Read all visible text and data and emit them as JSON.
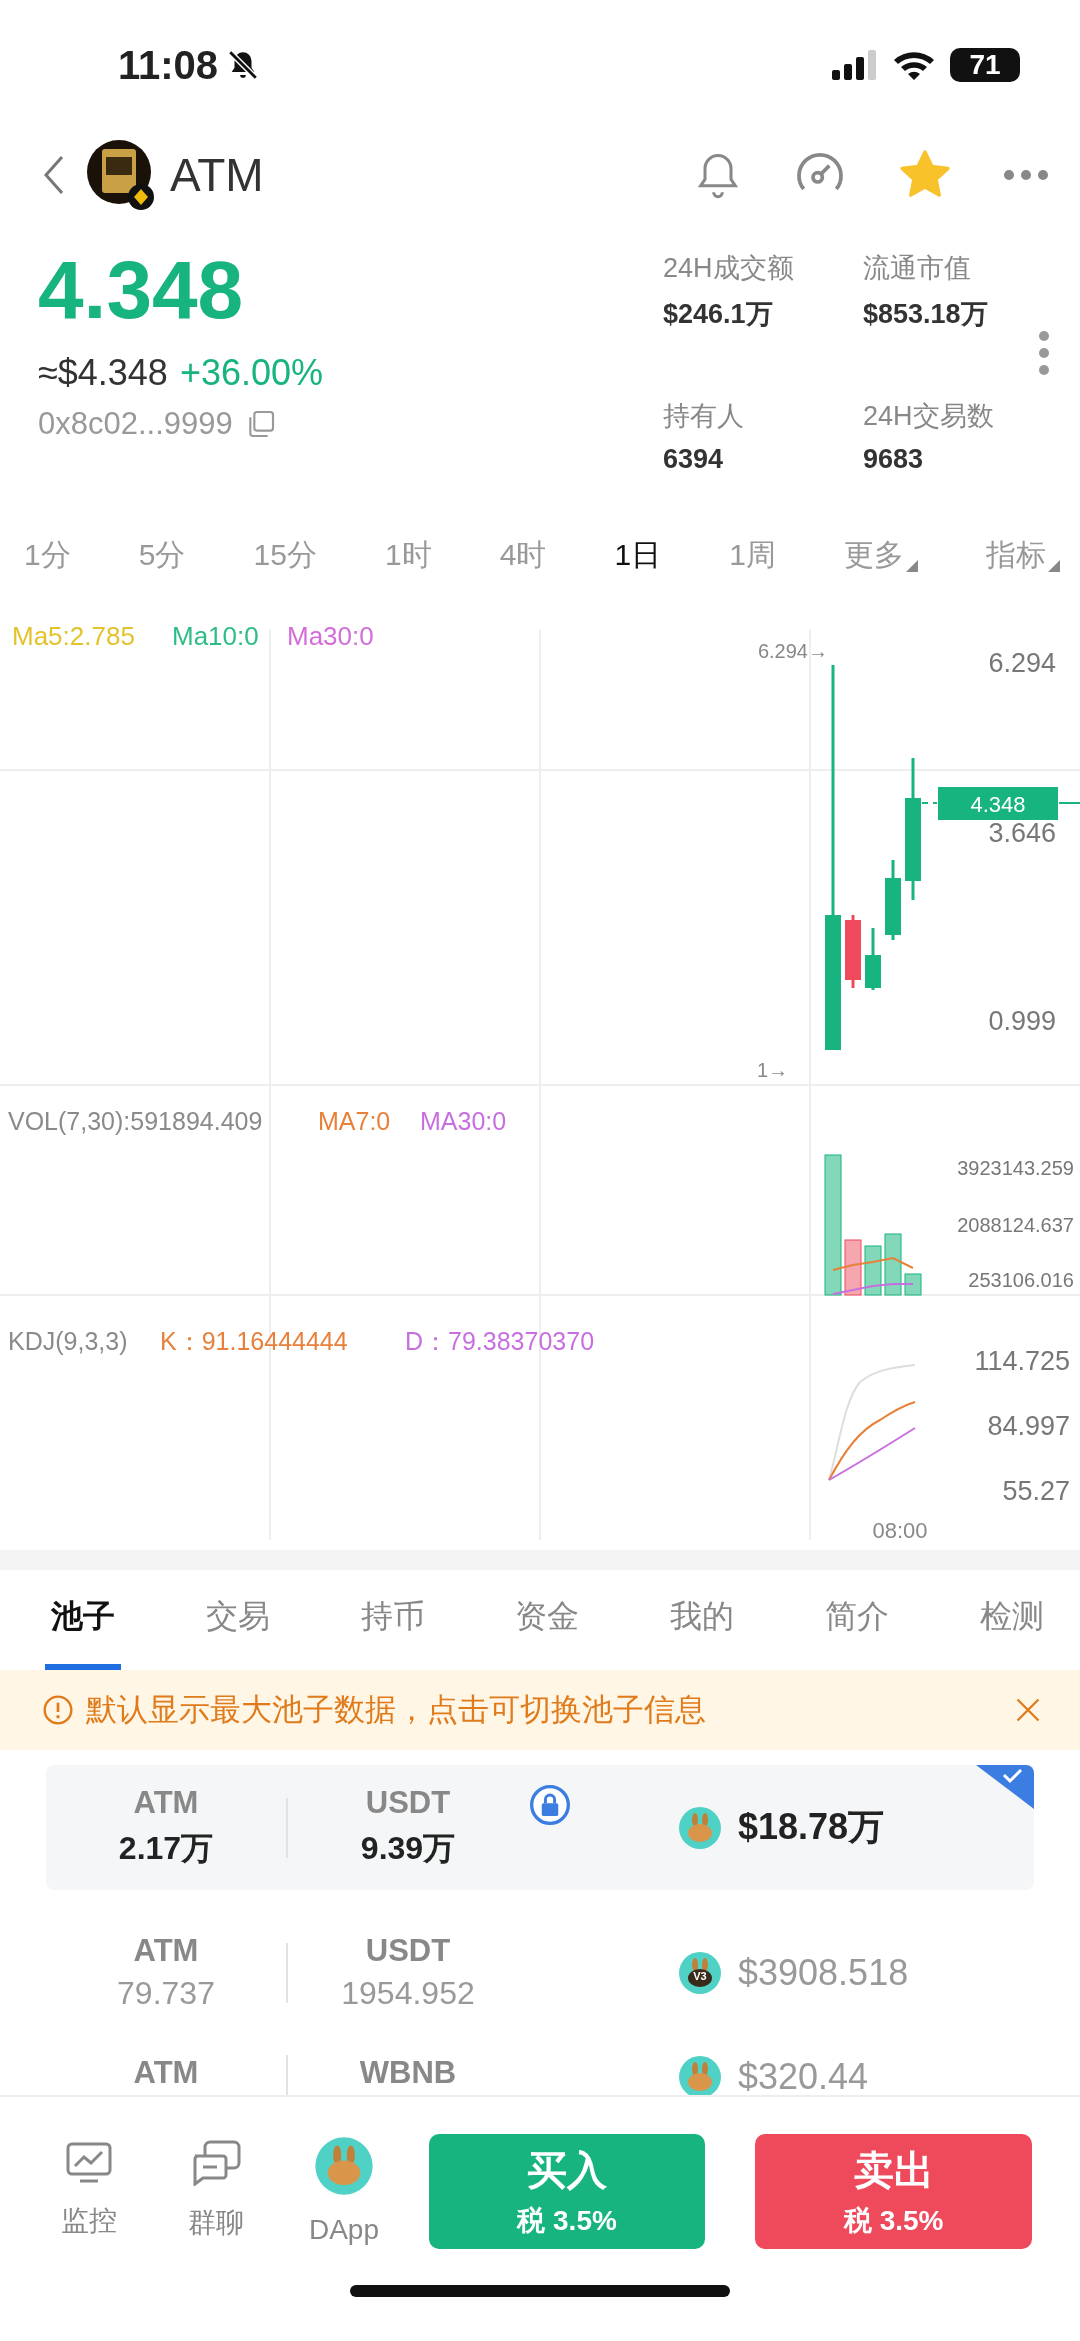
{
  "status_bar": {
    "time": "11:08",
    "battery": "71"
  },
  "header": {
    "title": "ATM",
    "favorite": true
  },
  "price": {
    "value": "4.348",
    "usd": "≈$4.348",
    "change": "+36.00%",
    "address": "0x8c02...9999"
  },
  "stats": [
    {
      "label": "24H成交额",
      "value": "$246.1万"
    },
    {
      "label": "流通市值",
      "value": "$853.18万"
    },
    {
      "label": "持有人",
      "value": "6394"
    },
    {
      "label": "24H交易数",
      "value": "9683"
    }
  ],
  "timeframes": [
    {
      "label": "1分",
      "selected": false,
      "dropdown": false
    },
    {
      "label": "5分",
      "selected": false,
      "dropdown": false
    },
    {
      "label": "15分",
      "selected": false,
      "dropdown": false
    },
    {
      "label": "1时",
      "selected": false,
      "dropdown": false
    },
    {
      "label": "4时",
      "selected": false,
      "dropdown": false
    },
    {
      "label": "1日",
      "selected": true,
      "dropdown": false
    },
    {
      "label": "1周",
      "selected": false,
      "dropdown": false
    },
    {
      "label": "更多",
      "selected": false,
      "dropdown": true
    },
    {
      "label": "指标",
      "selected": false,
      "dropdown": true
    }
  ],
  "chart": {
    "ma_legend": [
      {
        "text": "Ma5:2.785",
        "color": "#e3c22a"
      },
      {
        "text": "Ma10:0",
        "color": "#2ebd85"
      },
      {
        "text": "Ma30:0",
        "color": "#d36ed8"
      }
    ],
    "high_marker": "6.294→",
    "low_marker": "1→",
    "price_axis": [
      "6.294",
      "3.646",
      "0.999"
    ],
    "last_price": "4.348",
    "vol_legend": [
      {
        "text": "VOL(7,30):591894.409",
        "color": "#8a8a8a"
      },
      {
        "text": "MA7:0",
        "color": "#e8803a"
      },
      {
        "text": "MA30:0",
        "color": "#c86fe0"
      }
    ],
    "vol_axis": [
      "3923143.259",
      "2088124.637",
      "253106.016"
    ],
    "kdj_legend": [
      {
        "text": "KDJ(9,3,3)",
        "color": "#8a8a8a"
      },
      {
        "text": "K：91.16444444",
        "color": "#e8803a"
      },
      {
        "text": "D：79.38370370",
        "color": "#c86fe0"
      }
    ],
    "kdj_axis": [
      "114.725",
      "84.997",
      "55.27"
    ],
    "time_label": "08:00"
  },
  "tabs": [
    {
      "label": "池子",
      "selected": true
    },
    {
      "label": "交易",
      "selected": false
    },
    {
      "label": "持币",
      "selected": false
    },
    {
      "label": "资金",
      "selected": false
    },
    {
      "label": "我的",
      "selected": false
    },
    {
      "label": "简介",
      "selected": false
    },
    {
      "label": "检测",
      "selected": false
    }
  ],
  "notice": {
    "text": "默认显示最大池子数据，点击可切换池子信息"
  },
  "pools": [
    {
      "token_a": "ATM",
      "amount_a": "2.17万",
      "token_b": "USDT",
      "amount_b": "9.39万",
      "liquidity": "$18.78万",
      "locked": true,
      "selected": true
    },
    {
      "token_a": "ATM",
      "amount_a": "79.737",
      "token_b": "USDT",
      "amount_b": "1954.952",
      "liquidity": "$3908.518",
      "badge": "V3",
      "locked": false,
      "selected": false
    },
    {
      "token_a": "ATM",
      "token_b": "WBNB",
      "liquidity": "$320.44",
      "locked": false,
      "selected": false
    }
  ],
  "bottom_nav": [
    {
      "label": "监控",
      "kind": "monitor"
    },
    {
      "label": "群聊",
      "kind": "chat"
    },
    {
      "label": "DApp",
      "kind": "dapp"
    }
  ],
  "actions": [
    {
      "kind": "buy",
      "label": "买入",
      "tax": "税 3.5%"
    },
    {
      "kind": "sell",
      "label": "卖出",
      "tax": "税 3.5%"
    }
  ]
}
